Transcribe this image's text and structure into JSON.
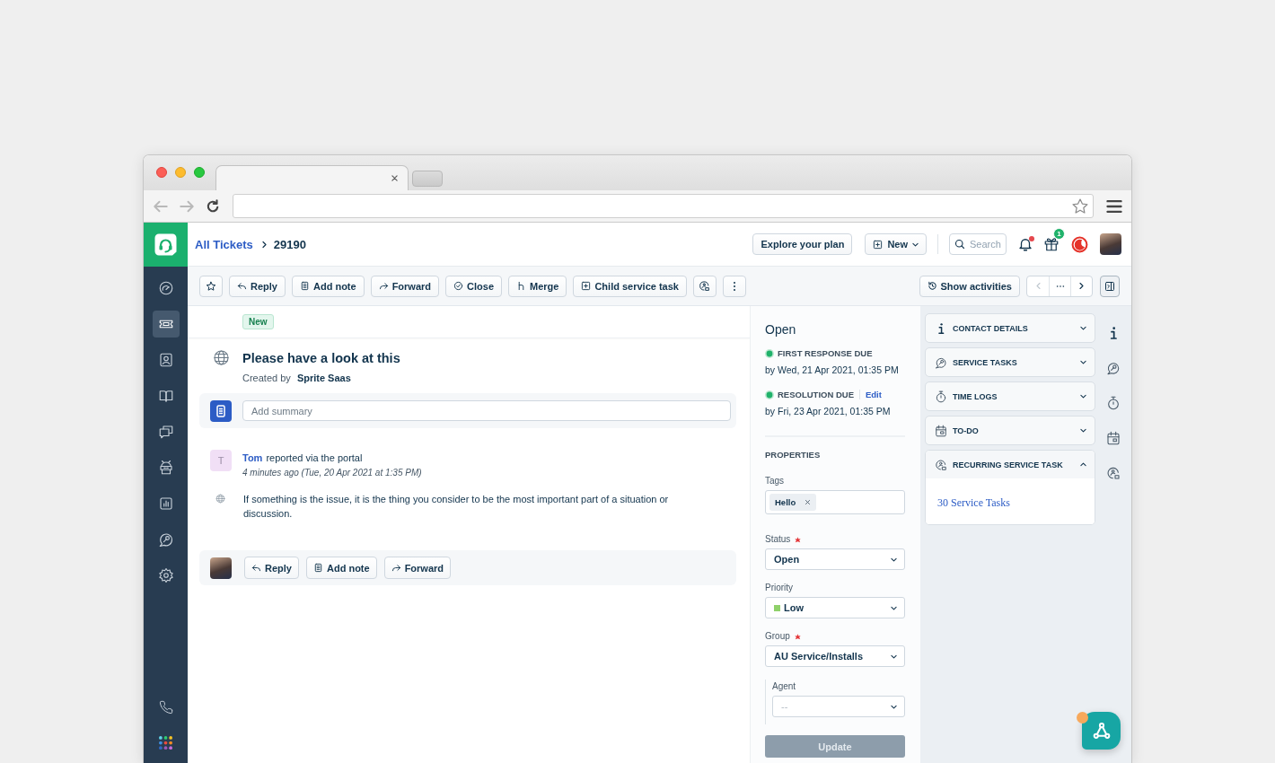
{
  "header": {
    "breadcrumb": {
      "parent": "All Tickets",
      "current": "29190"
    },
    "explore_button": "Explore your plan",
    "new_button": "New",
    "search": {
      "placeholder": "Search"
    },
    "notifications": {
      "unread": true
    },
    "gifts": {
      "badge": "1"
    }
  },
  "sidebar": {
    "items": [
      {
        "selected": false
      },
      {
        "selected": true
      },
      {
        "selected": false
      },
      {
        "selected": false
      },
      {
        "selected": false
      },
      {
        "selected": false
      },
      {
        "selected": false
      },
      {
        "selected": false
      },
      {
        "selected": false
      }
    ],
    "bottom_items": [
      {
        "selected": false
      },
      {
        "selected": false
      }
    ]
  },
  "toolbar": {
    "actions": [
      {
        "label": "Reply"
      },
      {
        "label": "Add note"
      },
      {
        "label": "Forward"
      },
      {
        "label": "Close"
      },
      {
        "label": "Merge"
      },
      {
        "label": "Child service task"
      }
    ],
    "show_activities": "Show activities"
  },
  "ticket": {
    "status_badge": "New",
    "title": "Please have a look at this",
    "created_by": "Created by **Sprite Saas**",
    "summary": {
      "placeholder": "Add summary"
    }
  },
  "conversation": {
    "avatar_initial": "T",
    "author": "Tom",
    "action": "reported via the portal",
    "time": "4 minutes ago (Tue, 20 Apr 2021 at 1:35 PM)",
    "body": "If something is the issue, it is the thing you consider to be the most important part of a situation or discussion."
  },
  "reply_bar": {
    "buttons": [
      {
        "label": "Reply"
      },
      {
        "label": "Add note"
      },
      {
        "label": "Forward"
      }
    ]
  },
  "sla": {
    "status": "Open",
    "items": [
      {
        "label": "FIRST RESPONSE DUE",
        "due": "by Wed, 21 Apr 2021, 01:35 PM"
      },
      {
        "label": "RESOLUTION DUE",
        "edit": "Edit",
        "due": "by Fri, 23 Apr 2021, 01:35 PM"
      }
    ]
  },
  "properties": {
    "heading": "PROPERTIES",
    "fields": [
      {
        "kind": "tags",
        "label": "Tags",
        "tags": [
          "Hello"
        ]
      },
      {
        "kind": "select",
        "label": "Status",
        "required": true,
        "value": "Open"
      },
      {
        "kind": "select",
        "label": "Priority",
        "value": "Low",
        "color": "#8fd16a"
      },
      {
        "kind": "select",
        "label": "Group",
        "required": true,
        "value": "AU Service/Installs"
      },
      {
        "kind": "select",
        "label": "Agent",
        "placeholder": "--",
        "dependent": true
      }
    ],
    "submit": {
      "label": "Update",
      "disabled": true
    }
  },
  "widgets": [
    {
      "title": "CONTACT DETAILS",
      "expanded": false
    },
    {
      "title": "SERVICE TASKS",
      "expanded": false
    },
    {
      "title": "TIME LOGS",
      "expanded": false
    },
    {
      "title": "TO-DO",
      "expanded": false
    },
    {
      "title": "RECURRING SERVICE TASK",
      "expanded": true,
      "link": "30 Service Tasks"
    }
  ],
  "chat_widget": {
    "unread": true
  }
}
